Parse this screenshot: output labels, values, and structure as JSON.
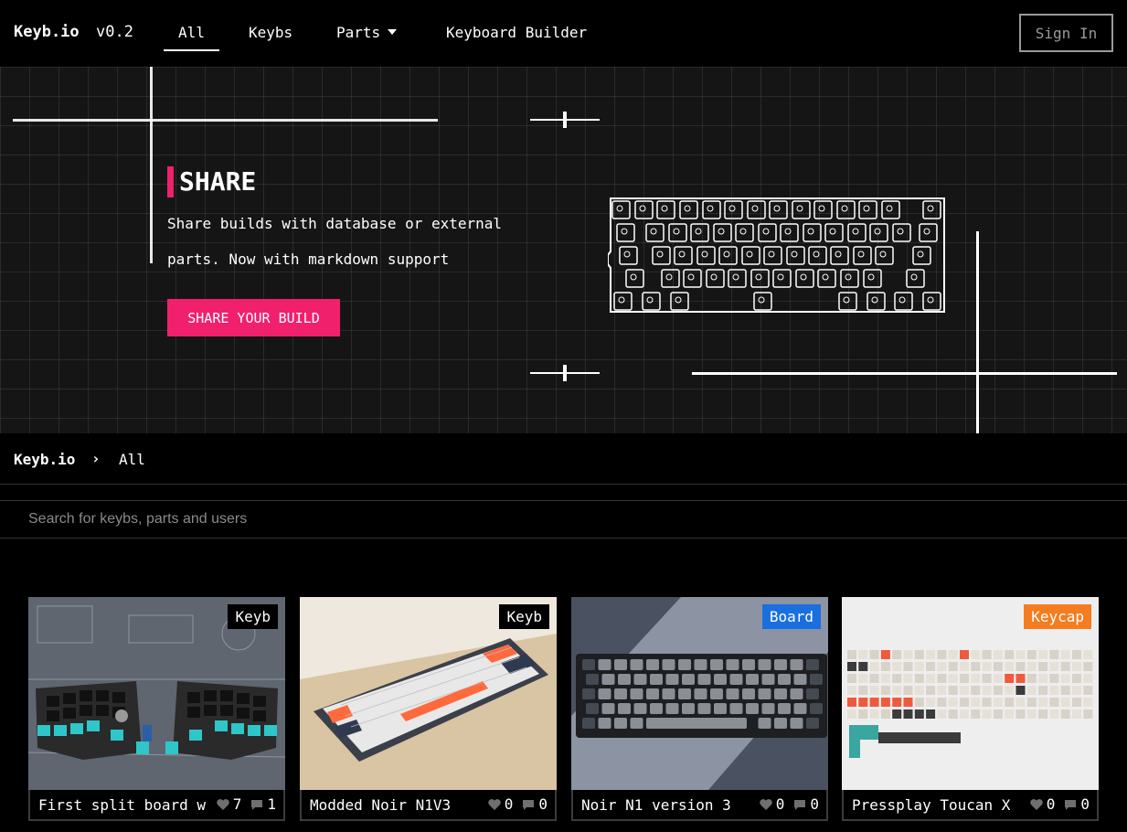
{
  "nav": {
    "brand": "Keyb.io",
    "version": "v0.2",
    "links": [
      {
        "label": "All",
        "active": true
      },
      {
        "label": "Keybs"
      },
      {
        "label": "Parts"
      },
      {
        "label": "Keyboard Builder"
      }
    ],
    "signin": "Sign In"
  },
  "hero": {
    "title": "SHARE",
    "text_line1": "Share builds with database or external",
    "text_line2": "parts. Now with markdown support",
    "button": "SHARE YOUR BUILD",
    "accent": "#f0206d"
  },
  "breadcrumb": {
    "home": "Keyb.io",
    "separator": "›",
    "current": "All"
  },
  "search": {
    "placeholder": "Search for keybs, parts and users"
  },
  "cards": [
    {
      "title": "First split board w",
      "badge": "Keyb",
      "badge_color": "#000000",
      "likes": "7",
      "comments": "1"
    },
    {
      "title": "Modded Noir N1V3",
      "badge": "Keyb",
      "badge_color": "#000000",
      "likes": "0",
      "comments": "0"
    },
    {
      "title": "Noir N1 version 3",
      "badge": "Board",
      "badge_color": "#1a6fe0",
      "likes": "0",
      "comments": "0"
    },
    {
      "title": "Pressplay Toucan X",
      "badge": "Keycap",
      "badge_color": "#f57c1f",
      "likes": "0",
      "comments": "0"
    }
  ],
  "icons": {
    "like": "heart-icon",
    "comment": "comment-icon",
    "dropdown": "chevron-down-icon"
  }
}
